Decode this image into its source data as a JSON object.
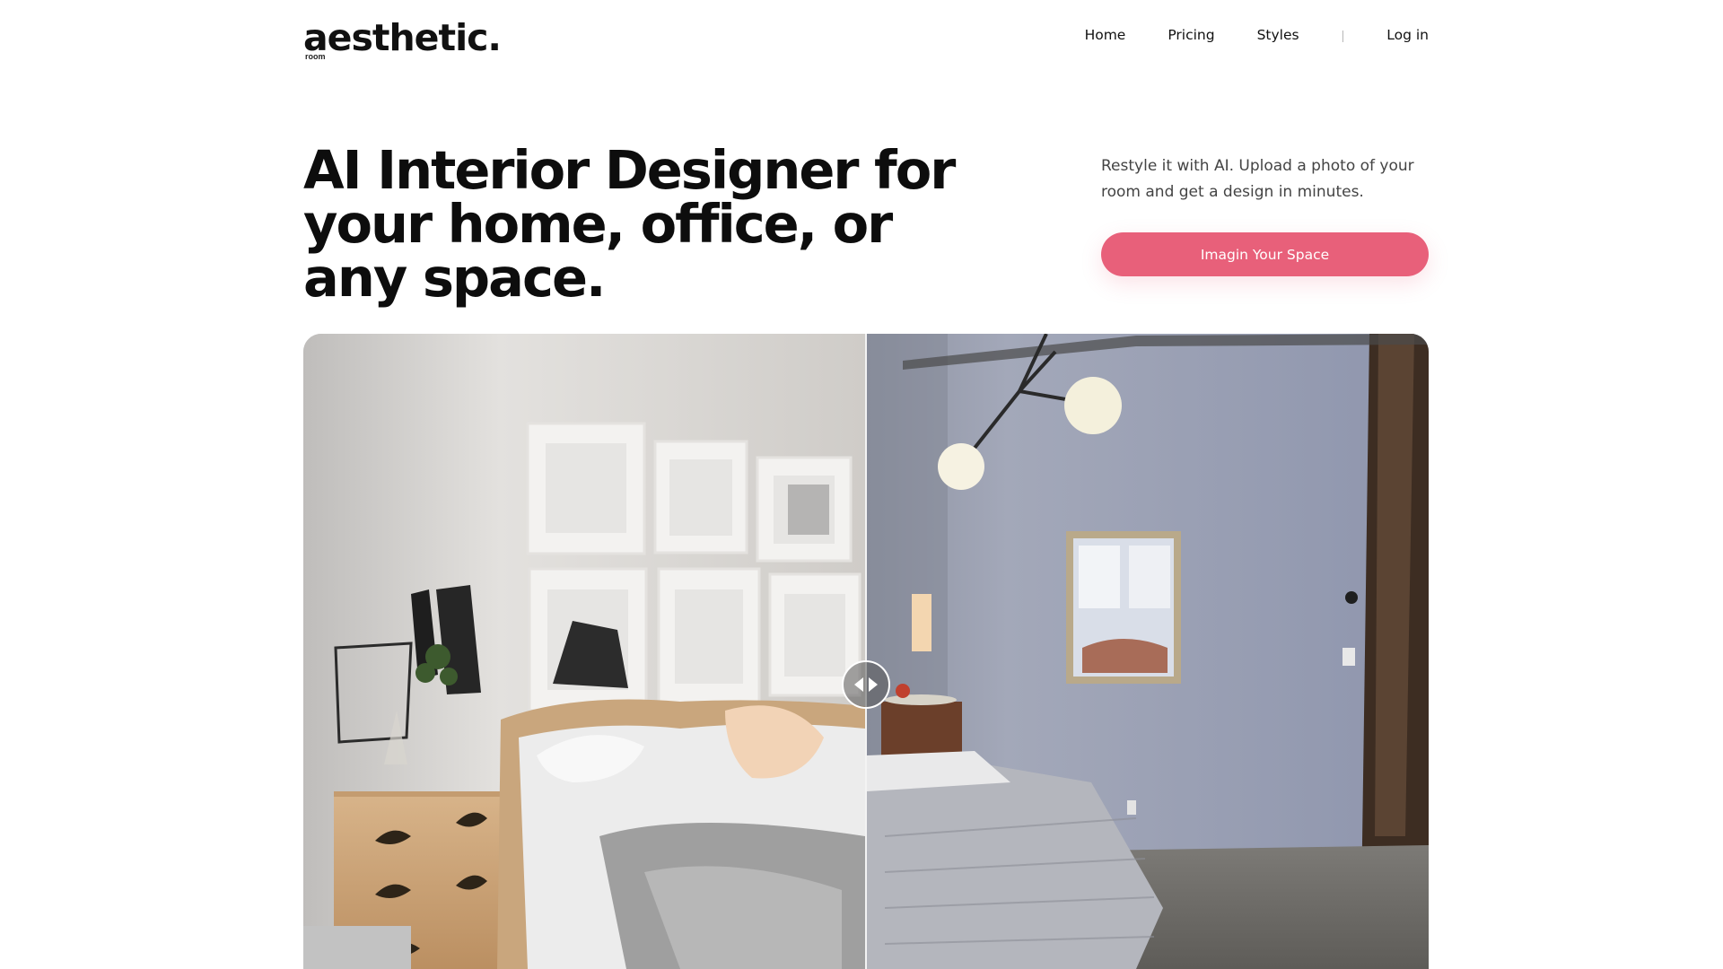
{
  "header": {
    "logo_text": "aesthetic.",
    "logo_sub": "room",
    "nav": {
      "home": "Home",
      "pricing": "Pricing",
      "styles": "Styles",
      "separator": "|",
      "login": "Log in"
    }
  },
  "hero": {
    "title": "AI Interior Designer for your home, office, or any space.",
    "description": "Restyle it with AI. Upload a photo of your room and get a design in minutes.",
    "cta_label": "Imagin Your Space"
  },
  "colors": {
    "accent": "#e8607a",
    "text": "#0d0d0d",
    "muted": "#444444"
  },
  "compare": {
    "handle_icon": "left-right-arrows-icon",
    "before_image": "styled bedroom photo",
    "after_image": "original bedroom photo",
    "divider_position": 0.5
  }
}
